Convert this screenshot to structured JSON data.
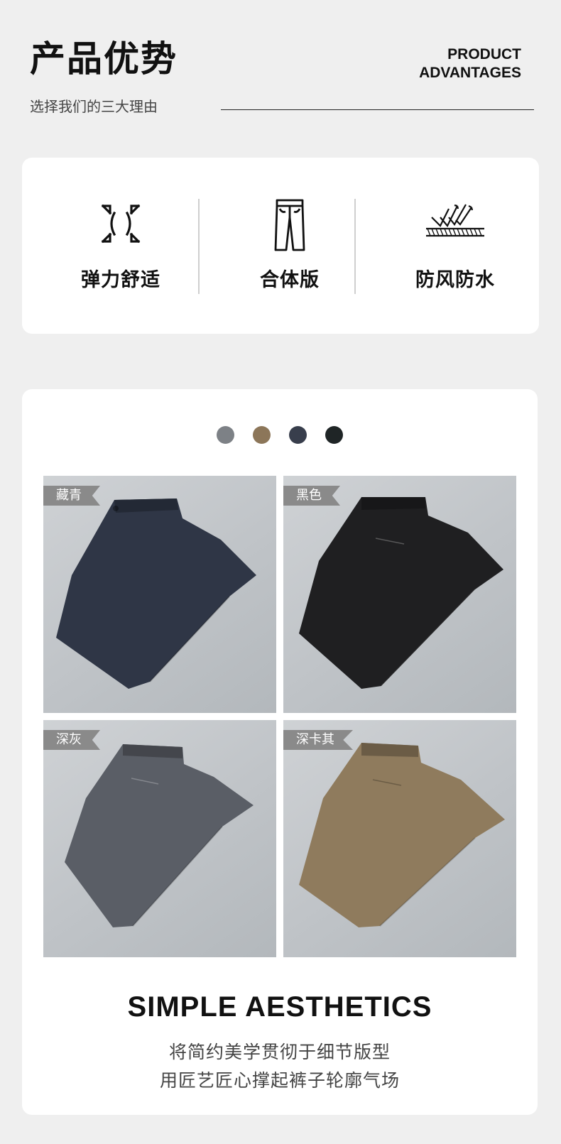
{
  "header": {
    "title_cn": "产品优势",
    "subtitle_cn": "选择我们的三大理由",
    "title_en_line1": "PRODUCT",
    "title_en_line2": "ADVANTAGES"
  },
  "advantages": [
    {
      "label": "弹力舒适",
      "icon": "stretch-arrows-icon"
    },
    {
      "label": "合体版",
      "icon": "trousers-icon"
    },
    {
      "label": "防风防水",
      "icon": "waterproof-fabric-icon"
    }
  ],
  "colors": {
    "swatches": [
      "#7d8186",
      "#8c7659",
      "#383e4c",
      "#1f2526"
    ],
    "products": [
      {
        "tag": "藏青",
        "color": "#2f3646"
      },
      {
        "tag": "黑色",
        "color": "#1f1f21"
      },
      {
        "tag": "深灰",
        "color": "#5a5e66"
      },
      {
        "tag": "深卡其",
        "color": "#8f7b5d"
      }
    ]
  },
  "footer": {
    "heading": "SIMPLE AESTHETICS",
    "line1": "将简约美学贯彻于细节版型",
    "line2": "用匠艺匠心撑起裤子轮廓气场"
  }
}
